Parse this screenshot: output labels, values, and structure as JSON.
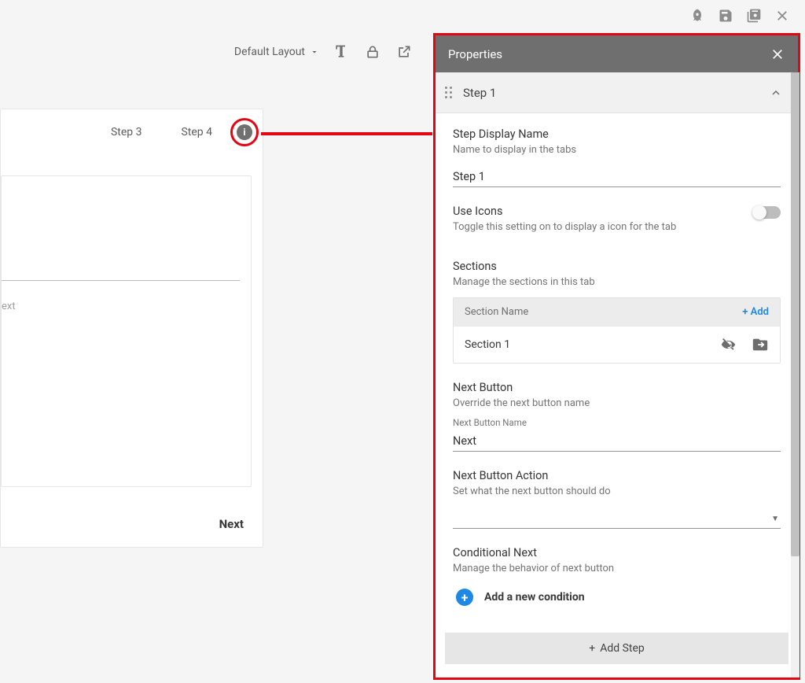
{
  "topbar": {
    "icons": [
      "rocket",
      "save",
      "save-all",
      "close"
    ]
  },
  "toolbar": {
    "layout_label": "Default Layout"
  },
  "form": {
    "tabs": [
      "Step 3",
      "Step 4"
    ],
    "placeholder": "ext",
    "next_label": "Next"
  },
  "panel": {
    "title": "Properties",
    "step": {
      "title": "Step 1",
      "display_name": {
        "label": "Step Display Name",
        "desc": "Name to display in the tabs",
        "value": "Step 1"
      },
      "use_icons": {
        "label": "Use Icons",
        "desc": "Toggle this setting on to display a icon for the tab",
        "enabled": false
      },
      "sections": {
        "label": "Sections",
        "desc": "Manage the sections in this tab",
        "header": "Section Name",
        "add_label": "+  Add",
        "rows": [
          "Section 1"
        ]
      },
      "next_button": {
        "label": "Next Button",
        "desc": "Override the next button name",
        "field_label": "Next Button Name",
        "value": "Next"
      },
      "next_action": {
        "label": "Next Button Action",
        "desc": "Set what the next button should do",
        "value": ""
      },
      "conditional_next": {
        "label": "Conditional Next",
        "desc": "Manage the behavior of next button",
        "add_label": "Add a new condition"
      }
    },
    "add_step_label": "Add Step"
  }
}
